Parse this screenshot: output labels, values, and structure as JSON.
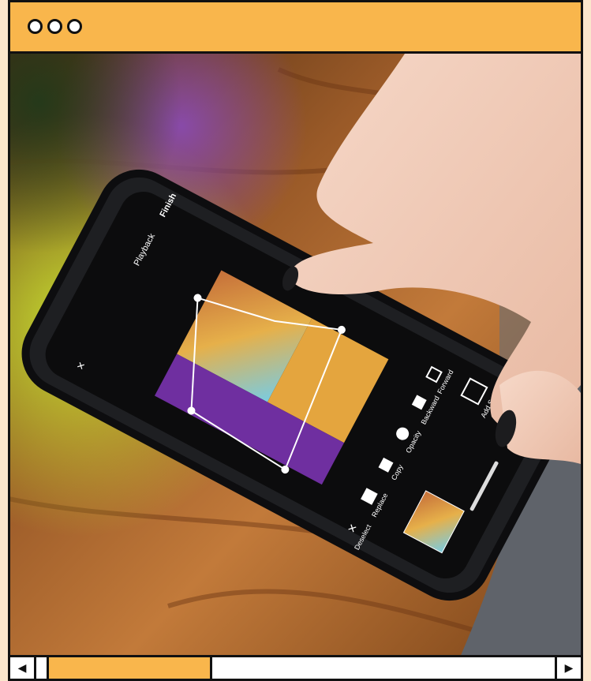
{
  "window": {
    "controls": [
      "window-dot-1",
      "window-dot-2",
      "window-dot-3"
    ],
    "accent_color": "#f9b64c",
    "background_color": "#fbe6cc"
  },
  "photo": {
    "phone_app": {
      "header_left": "Playback",
      "header_right": "Finish",
      "close_symbol": "×",
      "toolbar": [
        "Forward",
        "Backward",
        "Opacity",
        "Copy",
        "Replace",
        "Deselect"
      ],
      "add_scene": "Add Scene"
    }
  },
  "scrollbar": {
    "left_arrow": "◀",
    "right_arrow": "▶",
    "thumb_position_fraction": 0.05,
    "thumb_size_fraction": 0.3
  }
}
